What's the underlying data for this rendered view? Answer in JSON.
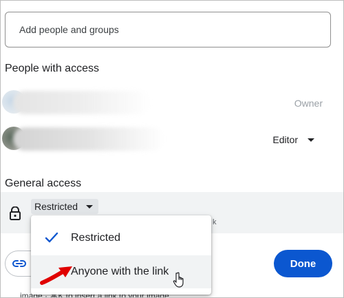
{
  "share_dialog": {
    "add_input": {
      "placeholder": "Add people and groups"
    },
    "people_section": {
      "title": "People with access",
      "people": [
        {
          "role": "Owner"
        },
        {
          "role": "Editor"
        }
      ]
    },
    "general_section": {
      "title": "General access",
      "selected_access": "Restricted",
      "partial_text": "k"
    },
    "access_menu": {
      "options": [
        {
          "label": "Restricted",
          "checked": true
        },
        {
          "label": "Anyone with the link",
          "checked": false
        }
      ]
    },
    "footer": {
      "done_label": "Done",
      "link_icon": "link-icon"
    },
    "background_text": "image · ⌘K to insert a link to your image."
  },
  "colors": {
    "accent": "#0b57d0",
    "check": "#0b57d0",
    "annotation_arrow": "#e00000",
    "band": "#f1f3f4"
  },
  "icons": [
    "lock-icon",
    "check-icon",
    "link-icon",
    "caret-down-icon",
    "hand-cursor-icon",
    "red-arrow-annotation"
  ]
}
